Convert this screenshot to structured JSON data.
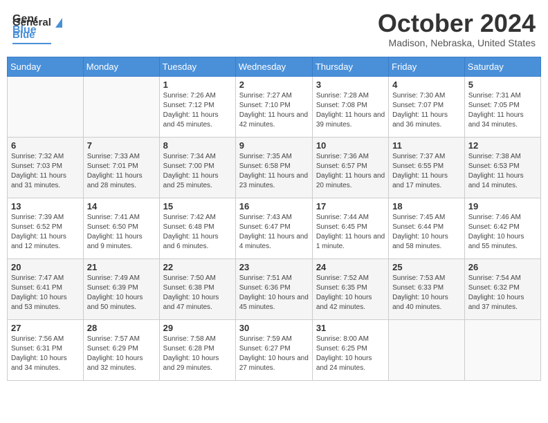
{
  "header": {
    "logo_line1": "General",
    "logo_line2": "Blue",
    "month": "October 2024",
    "location": "Madison, Nebraska, United States"
  },
  "days_of_week": [
    "Sunday",
    "Monday",
    "Tuesday",
    "Wednesday",
    "Thursday",
    "Friday",
    "Saturday"
  ],
  "weeks": [
    [
      {
        "day": "",
        "sunrise": "",
        "sunset": "",
        "daylight": ""
      },
      {
        "day": "",
        "sunrise": "",
        "sunset": "",
        "daylight": ""
      },
      {
        "day": "1",
        "sunrise": "Sunrise: 7:26 AM",
        "sunset": "Sunset: 7:12 PM",
        "daylight": "Daylight: 11 hours and 45 minutes."
      },
      {
        "day": "2",
        "sunrise": "Sunrise: 7:27 AM",
        "sunset": "Sunset: 7:10 PM",
        "daylight": "Daylight: 11 hours and 42 minutes."
      },
      {
        "day": "3",
        "sunrise": "Sunrise: 7:28 AM",
        "sunset": "Sunset: 7:08 PM",
        "daylight": "Daylight: 11 hours and 39 minutes."
      },
      {
        "day": "4",
        "sunrise": "Sunrise: 7:30 AM",
        "sunset": "Sunset: 7:07 PM",
        "daylight": "Daylight: 11 hours and 36 minutes."
      },
      {
        "day": "5",
        "sunrise": "Sunrise: 7:31 AM",
        "sunset": "Sunset: 7:05 PM",
        "daylight": "Daylight: 11 hours and 34 minutes."
      }
    ],
    [
      {
        "day": "6",
        "sunrise": "Sunrise: 7:32 AM",
        "sunset": "Sunset: 7:03 PM",
        "daylight": "Daylight: 11 hours and 31 minutes."
      },
      {
        "day": "7",
        "sunrise": "Sunrise: 7:33 AM",
        "sunset": "Sunset: 7:01 PM",
        "daylight": "Daylight: 11 hours and 28 minutes."
      },
      {
        "day": "8",
        "sunrise": "Sunrise: 7:34 AM",
        "sunset": "Sunset: 7:00 PM",
        "daylight": "Daylight: 11 hours and 25 minutes."
      },
      {
        "day": "9",
        "sunrise": "Sunrise: 7:35 AM",
        "sunset": "Sunset: 6:58 PM",
        "daylight": "Daylight: 11 hours and 23 minutes."
      },
      {
        "day": "10",
        "sunrise": "Sunrise: 7:36 AM",
        "sunset": "Sunset: 6:57 PM",
        "daylight": "Daylight: 11 hours and 20 minutes."
      },
      {
        "day": "11",
        "sunrise": "Sunrise: 7:37 AM",
        "sunset": "Sunset: 6:55 PM",
        "daylight": "Daylight: 11 hours and 17 minutes."
      },
      {
        "day": "12",
        "sunrise": "Sunrise: 7:38 AM",
        "sunset": "Sunset: 6:53 PM",
        "daylight": "Daylight: 11 hours and 14 minutes."
      }
    ],
    [
      {
        "day": "13",
        "sunrise": "Sunrise: 7:39 AM",
        "sunset": "Sunset: 6:52 PM",
        "daylight": "Daylight: 11 hours and 12 minutes."
      },
      {
        "day": "14",
        "sunrise": "Sunrise: 7:41 AM",
        "sunset": "Sunset: 6:50 PM",
        "daylight": "Daylight: 11 hours and 9 minutes."
      },
      {
        "day": "15",
        "sunrise": "Sunrise: 7:42 AM",
        "sunset": "Sunset: 6:48 PM",
        "daylight": "Daylight: 11 hours and 6 minutes."
      },
      {
        "day": "16",
        "sunrise": "Sunrise: 7:43 AM",
        "sunset": "Sunset: 6:47 PM",
        "daylight": "Daylight: 11 hours and 4 minutes."
      },
      {
        "day": "17",
        "sunrise": "Sunrise: 7:44 AM",
        "sunset": "Sunset: 6:45 PM",
        "daylight": "Daylight: 11 hours and 1 minute."
      },
      {
        "day": "18",
        "sunrise": "Sunrise: 7:45 AM",
        "sunset": "Sunset: 6:44 PM",
        "daylight": "Daylight: 10 hours and 58 minutes."
      },
      {
        "day": "19",
        "sunrise": "Sunrise: 7:46 AM",
        "sunset": "Sunset: 6:42 PM",
        "daylight": "Daylight: 10 hours and 55 minutes."
      }
    ],
    [
      {
        "day": "20",
        "sunrise": "Sunrise: 7:47 AM",
        "sunset": "Sunset: 6:41 PM",
        "daylight": "Daylight: 10 hours and 53 minutes."
      },
      {
        "day": "21",
        "sunrise": "Sunrise: 7:49 AM",
        "sunset": "Sunset: 6:39 PM",
        "daylight": "Daylight: 10 hours and 50 minutes."
      },
      {
        "day": "22",
        "sunrise": "Sunrise: 7:50 AM",
        "sunset": "Sunset: 6:38 PM",
        "daylight": "Daylight: 10 hours and 47 minutes."
      },
      {
        "day": "23",
        "sunrise": "Sunrise: 7:51 AM",
        "sunset": "Sunset: 6:36 PM",
        "daylight": "Daylight: 10 hours and 45 minutes."
      },
      {
        "day": "24",
        "sunrise": "Sunrise: 7:52 AM",
        "sunset": "Sunset: 6:35 PM",
        "daylight": "Daylight: 10 hours and 42 minutes."
      },
      {
        "day": "25",
        "sunrise": "Sunrise: 7:53 AM",
        "sunset": "Sunset: 6:33 PM",
        "daylight": "Daylight: 10 hours and 40 minutes."
      },
      {
        "day": "26",
        "sunrise": "Sunrise: 7:54 AM",
        "sunset": "Sunset: 6:32 PM",
        "daylight": "Daylight: 10 hours and 37 minutes."
      }
    ],
    [
      {
        "day": "27",
        "sunrise": "Sunrise: 7:56 AM",
        "sunset": "Sunset: 6:31 PM",
        "daylight": "Daylight: 10 hours and 34 minutes."
      },
      {
        "day": "28",
        "sunrise": "Sunrise: 7:57 AM",
        "sunset": "Sunset: 6:29 PM",
        "daylight": "Daylight: 10 hours and 32 minutes."
      },
      {
        "day": "29",
        "sunrise": "Sunrise: 7:58 AM",
        "sunset": "Sunset: 6:28 PM",
        "daylight": "Daylight: 10 hours and 29 minutes."
      },
      {
        "day": "30",
        "sunrise": "Sunrise: 7:59 AM",
        "sunset": "Sunset: 6:27 PM",
        "daylight": "Daylight: 10 hours and 27 minutes."
      },
      {
        "day": "31",
        "sunrise": "Sunrise: 8:00 AM",
        "sunset": "Sunset: 6:25 PM",
        "daylight": "Daylight: 10 hours and 24 minutes."
      },
      {
        "day": "",
        "sunrise": "",
        "sunset": "",
        "daylight": ""
      },
      {
        "day": "",
        "sunrise": "",
        "sunset": "",
        "daylight": ""
      }
    ]
  ]
}
